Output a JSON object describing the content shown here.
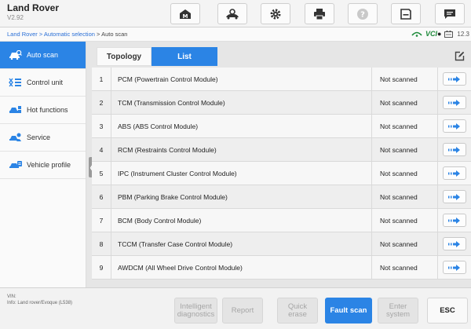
{
  "app": {
    "title": "Land Rover",
    "version": "V2.92"
  },
  "toolbar": {
    "icons": [
      "home-icon",
      "vehicle-service-icon",
      "settings-icon",
      "printer-icon",
      "help-icon",
      "save-icon",
      "message-icon"
    ]
  },
  "breadcrumb": {
    "link": "Land Rover > Automatic selection",
    "sep": " > ",
    "current": "Auto scan"
  },
  "status": {
    "vci_label": "VCI",
    "battery_text": "12.3"
  },
  "sidebar": {
    "items": [
      {
        "label": "Auto scan",
        "icon": "car-scan-icon",
        "active": true
      },
      {
        "label": "Control unit",
        "icon": "control-unit-icon",
        "active": false
      },
      {
        "label": "Hot functions",
        "icon": "hot-functions-icon",
        "active": false
      },
      {
        "label": "Service",
        "icon": "service-icon",
        "active": false
      },
      {
        "label": "Vehicle profile",
        "icon": "vehicle-profile-icon",
        "active": false
      }
    ]
  },
  "tabs": {
    "topology": "Topology",
    "list": "List",
    "active": "list"
  },
  "modules": [
    {
      "num": "1",
      "name": "PCM (Powertrain Control Module)",
      "status": "Not scanned"
    },
    {
      "num": "2",
      "name": "TCM (Transmission Control Module)",
      "status": "Not scanned"
    },
    {
      "num": "3",
      "name": "ABS (ABS Control Module)",
      "status": "Not scanned"
    },
    {
      "num": "4",
      "name": "RCM (Restraints Control Module)",
      "status": "Not scanned"
    },
    {
      "num": "5",
      "name": "IPC (Instrument Cluster Control Module)",
      "status": "Not scanned"
    },
    {
      "num": "6",
      "name": "PBM (Parking Brake Control Module)",
      "status": "Not scanned"
    },
    {
      "num": "7",
      "name": "BCM (Body Control Module)",
      "status": "Not scanned"
    },
    {
      "num": "8",
      "name": "TCCM (Transfer Case Control Module)",
      "status": "Not scanned"
    },
    {
      "num": "9",
      "name": "AWDCM (All Wheel Drive Control Module)",
      "status": "Not scanned"
    }
  ],
  "footer": {
    "vin_label": "VIN:",
    "info": "Info: Land rover/Evoque (L538)",
    "buttons": {
      "intelligent_l1": "Intelligent",
      "intelligent_l2": "diagnostics",
      "report": "Report",
      "quick_l1": "Quick",
      "quick_l2": "erase",
      "fault_scan": "Fault scan",
      "enter_l1": "Enter",
      "enter_l2": "system",
      "esc": "ESC"
    }
  },
  "colors": {
    "accent": "#2b84e5",
    "vci_green": "#1d8a3a",
    "disabled_text": "#a6a6a6"
  }
}
